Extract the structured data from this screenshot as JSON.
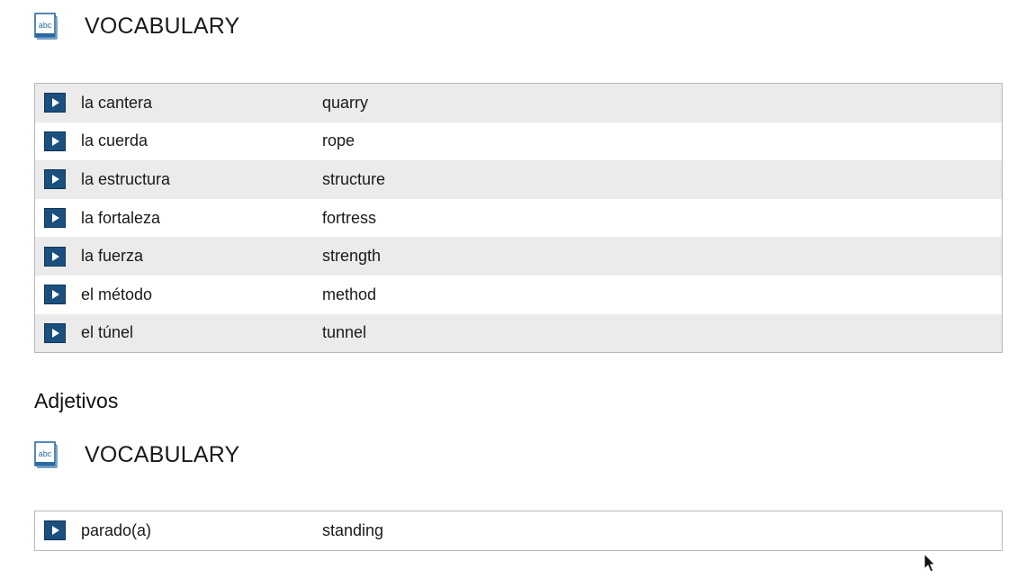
{
  "sections": [
    {
      "header": {
        "icon": "vocabulary-book-icon",
        "icon_text": "abc",
        "title": "VOCABULARY"
      },
      "rows": [
        {
          "term": "la cantera",
          "translation": "quarry"
        },
        {
          "term": "la cuerda",
          "translation": "rope"
        },
        {
          "term": "la estructura",
          "translation": "structure"
        },
        {
          "term": "la fortaleza",
          "translation": "fortress"
        },
        {
          "term": "la fuerza",
          "translation": "strength"
        },
        {
          "term": "el método",
          "translation": "method"
        },
        {
          "term": "el túnel",
          "translation": "tunnel"
        }
      ]
    },
    {
      "heading": "Adjetivos",
      "header": {
        "icon": "vocabulary-book-icon",
        "icon_text": "abc",
        "title": "VOCABULARY"
      },
      "rows": [
        {
          "term": "parado(a)",
          "translation": "standing"
        }
      ]
    }
  ],
  "icons": {
    "play": "play-icon",
    "pointer": "mouse-pointer-icon"
  },
  "colors": {
    "play_button": "#1b4f7e",
    "row_shaded": "#ebebeb",
    "table_border": "#b8b8b8"
  }
}
